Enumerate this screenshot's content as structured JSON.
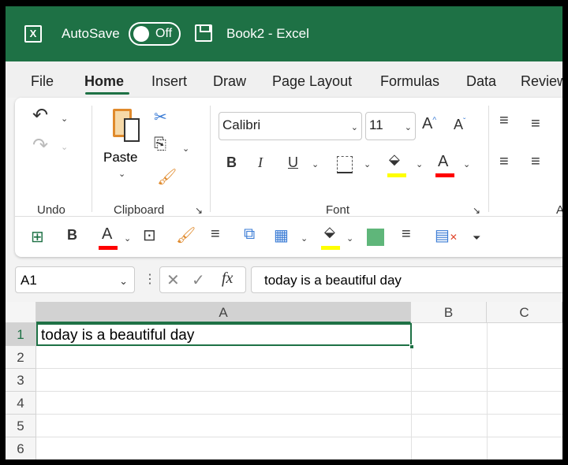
{
  "title": {
    "autosave": "AutoSave",
    "toggle": "Off",
    "book": "Book2  -  Excel"
  },
  "menu": [
    "File",
    "Home",
    "Insert",
    "Draw",
    "Page Layout",
    "Formulas",
    "Data",
    "Review"
  ],
  "ribbon": {
    "paste": "Paste",
    "groups": {
      "undo": "Undo",
      "clipboard": "Clipboard",
      "font": "Font",
      "align": "A"
    },
    "font_name": "Calibri",
    "font_size": "11",
    "bold": "B",
    "italic": "I",
    "underline": "U",
    "font_color_letter": "A",
    "qat_bold": "B"
  },
  "colors": {
    "accent": "#1e7145",
    "highlight": "#ffff00",
    "font_color": "#ff0000",
    "fill": "#5fb67a"
  },
  "formula_bar": {
    "name_box": "A1",
    "fx": "fx",
    "content": "today is a beautiful day"
  },
  "sheet": {
    "columns": [
      "A",
      "B",
      "C"
    ],
    "rows": [
      "1",
      "2",
      "3",
      "4",
      "5",
      "6"
    ],
    "a1": "today is a beautiful day"
  }
}
